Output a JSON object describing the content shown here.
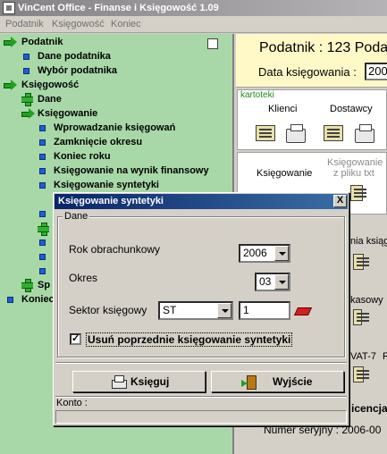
{
  "window": {
    "title": "VinCent Office - Finanse i Księgowość 1.09"
  },
  "menu": {
    "items": [
      "Podatnik",
      "Księgowość",
      "Koniec"
    ]
  },
  "tree": {
    "items": [
      {
        "label": "Podatnik",
        "icon": "green-arrow-icon"
      },
      {
        "label": "Dane podatnika",
        "icon": "blue-square-icon"
      },
      {
        "label": "Wybór podatnika",
        "icon": "blue-square-icon"
      },
      {
        "label": "Księgowość",
        "icon": "green-arrow-icon"
      },
      {
        "label": "Dane",
        "icon": "green-plus-icon"
      },
      {
        "label": "Księgowanie",
        "icon": "green-arrow-icon"
      },
      {
        "label": "Wprowadzanie księgowań",
        "icon": "blue-square-icon"
      },
      {
        "label": "Zamknięcie okresu",
        "icon": "blue-square-icon"
      },
      {
        "label": "Koniec roku",
        "icon": "blue-square-icon"
      },
      {
        "label": "Księgowanie na wynik finansowy",
        "icon": "blue-square-icon"
      },
      {
        "label": "Księgowanie syntetyki",
        "icon": "blue-square-icon"
      },
      {
        "label": "Sp",
        "icon": "green-plus-icon"
      },
      {
        "label": "Koniec",
        "icon": "blue-square-icon"
      }
    ]
  },
  "right_panel": {
    "podatnik_title": "Podatnik : 123 Poda",
    "data_label": "Data księgowania :",
    "data_value": "200",
    "kartoteki_label": "kartoteki",
    "klienci": "Klienci",
    "dostawcy": "Dostawcy",
    "ksiegowanie": "Księgowanie",
    "ksiegowanie_z_pliku_line1": "Księgowanie",
    "ksiegowanie_z_pliku_line2": "z pliku txt",
    "frag_ksiag": "nia ksiąg",
    "frag_kasowy": "kasowy",
    "frag_vat": "VAT-7",
    "frag_vat2": "R",
    "frag_licencja": "icencja",
    "numer_seryjny": "Numer seryjny : 2006-00"
  },
  "dialog": {
    "title": "Księgowanie syntetyki",
    "close_label": "X",
    "group_label": "Dane",
    "rok_label": "Rok obrachunkowy",
    "rok_value": "2006",
    "okres_label": "Okres",
    "okres_value": "03",
    "sektor_label": "Sektor księgowy",
    "sektor_value": "ST",
    "sektor_number": "1",
    "checkbox_label": "Usuń poprzednie księgowanie syntetyki",
    "checkbox_checked": true,
    "checkbox_mark": "✓",
    "ksieguj_label": "Księguj",
    "wyjscie_label": "Wyjście",
    "konto_label": "Konto :"
  }
}
